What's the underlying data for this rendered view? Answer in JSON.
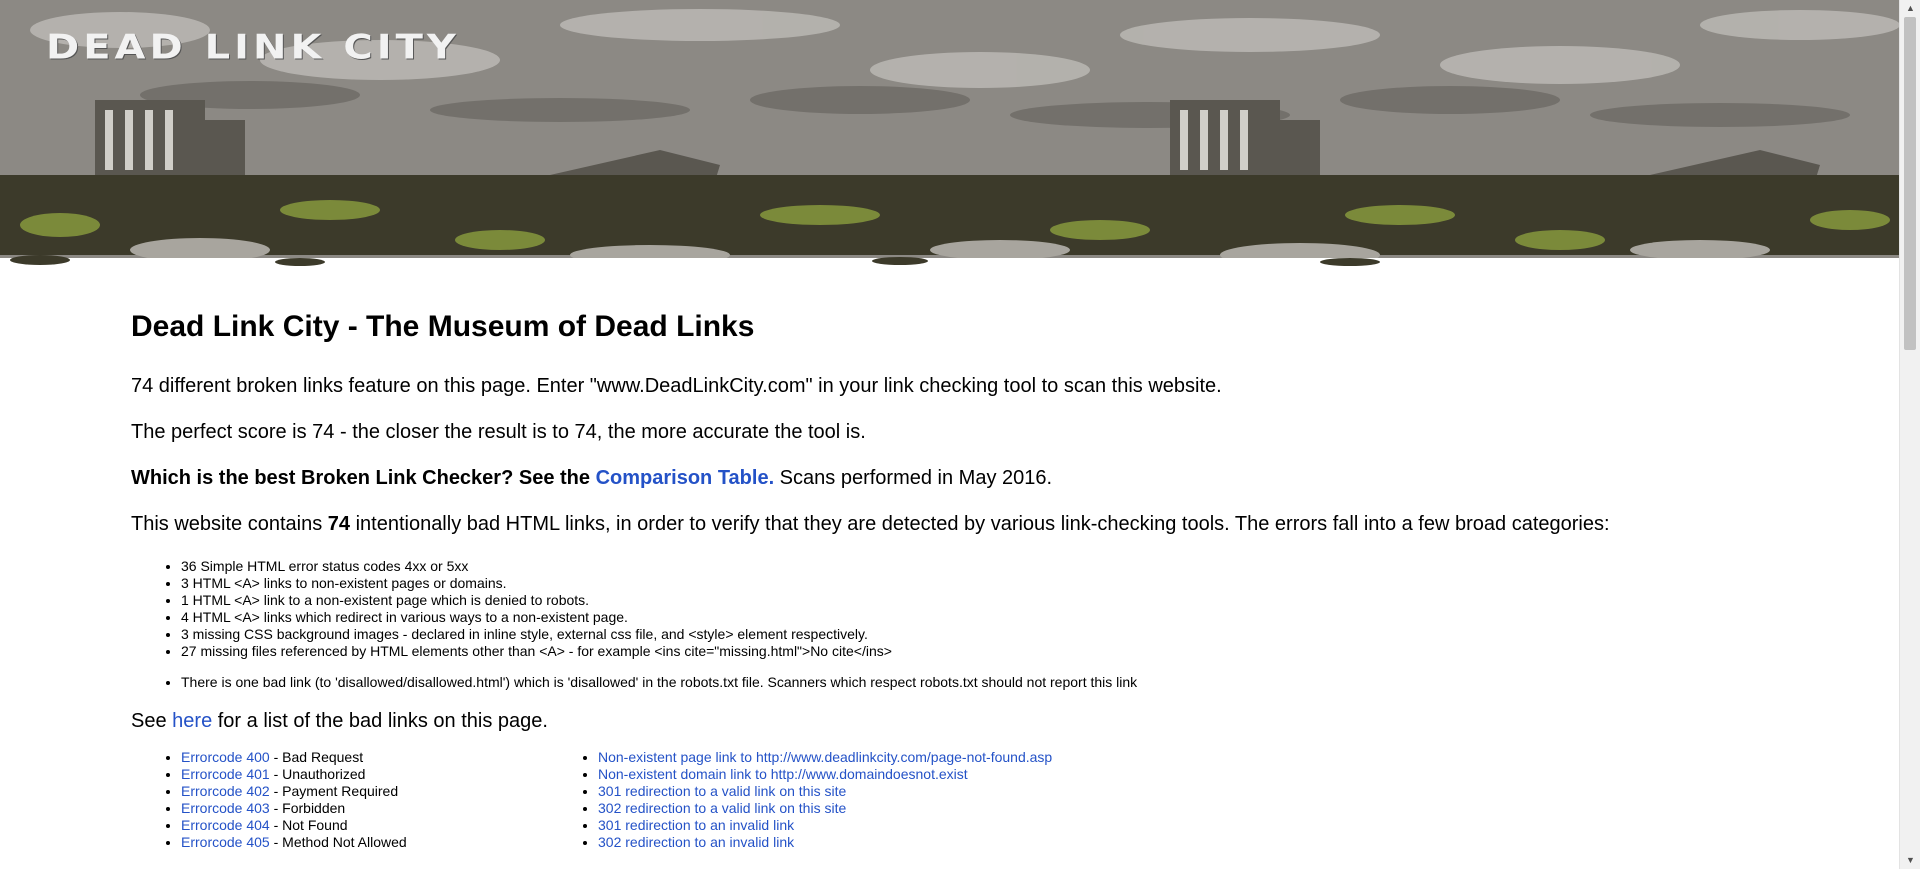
{
  "header": {
    "logo": "DEAD LINK CITY"
  },
  "main": {
    "title": "Dead Link City - The Museum of Dead Links",
    "p1": "74 different broken links feature on this page. Enter \"www.DeadLinkCity.com\" in your link checking tool to scan this website.",
    "p2": "The perfect score is 74 - the closer the result is to 74, the more accurate the tool is.",
    "p3_bold": "Which is the best Broken Link Checker? See the",
    "p3_link": "Comparison Table.",
    "p3_tail": " Scans performed in May 2016.",
    "p4_a": "This website contains ",
    "p4_bold": "74",
    "p4_b": " intentionally bad HTML links, in order to verify that they are detected by various link-checking tools. The errors fall into a few broad categories:",
    "categories": [
      "36 Simple HTML error status codes 4xx or 5xx",
      "3 HTML <A> links to non-existent pages or domains.",
      "1 HTML <A> link to a non-existent page which is denied to robots.",
      "4 HTML <A> links which redirect in various ways to a non-existent page.",
      "3 missing CSS background images - declared in inline style, external css file, and <style> element respectively.",
      "27 missing files referenced by HTML elements other than <A> - for example <ins cite=\"missing.html\">No cite</ins>"
    ],
    "note": "There is one bad link (to 'disallowed/disallowed.html') which is 'disallowed' in the robots.txt file. Scanners which respect robots.txt should not report this link",
    "see_a": "See ",
    "see_link": "here",
    "see_b": " for a list of the bad links on this page.",
    "errorcodes": [
      {
        "link": "Errorcode 400",
        "desc": " - Bad Request"
      },
      {
        "link": "Errorcode 401",
        "desc": " - Unauthorized"
      },
      {
        "link": "Errorcode 402",
        "desc": " - Payment Required"
      },
      {
        "link": "Errorcode 403",
        "desc": " - Forbidden"
      },
      {
        "link": "Errorcode 404",
        "desc": " - Not Found"
      },
      {
        "link": "Errorcode 405",
        "desc": " - Method Not Allowed"
      }
    ],
    "other_links": [
      "Non-existent page link to http://www.deadlinkcity.com/page-not-found.asp",
      "Non-existent domain link to http://www.domaindoesnot.exist",
      "301 redirection to a valid link on this site",
      "302 redirection to a valid link on this site",
      "301 redirection to an invalid link",
      "302 redirection to an invalid link"
    ]
  },
  "colors": {
    "link": "#2452c7",
    "sky": "#8a8782",
    "ground": "#3c3a2a"
  }
}
